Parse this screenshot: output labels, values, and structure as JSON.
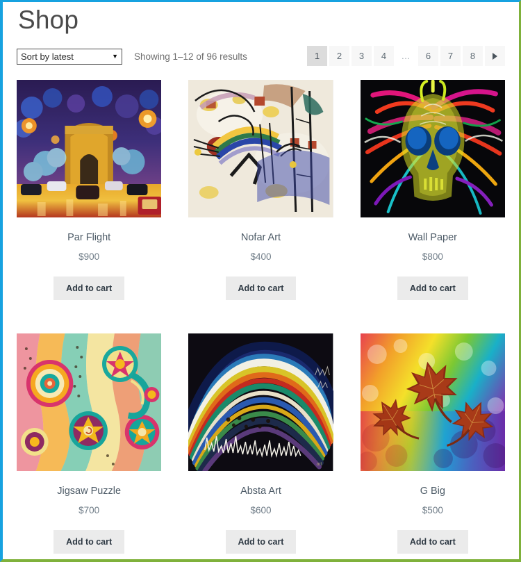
{
  "theme": {
    "border_top_left": "#17a2e0",
    "border_right_bottom": "#7fb13b",
    "button_bg": "#ebebeb",
    "pagination_active_bg": "#dcdcdc",
    "pagination_bg": "#f7f7f7"
  },
  "header": {
    "title": "Shop"
  },
  "toolbar": {
    "sort": {
      "selected": "Sort by latest",
      "options": [
        "Sort by latest"
      ],
      "caret": "▼"
    },
    "result_count": "Showing 1–12 of 96 results"
  },
  "pagination": {
    "items": [
      {
        "label": "1",
        "current": true
      },
      {
        "label": "2",
        "current": false
      },
      {
        "label": "3",
        "current": false
      },
      {
        "label": "4",
        "current": false
      },
      {
        "label": "…",
        "current": false,
        "dots": true
      },
      {
        "label": "6",
        "current": false
      },
      {
        "label": "7",
        "current": false
      },
      {
        "label": "8",
        "current": false
      }
    ],
    "next_label": "→",
    "next_icon": "arrow-right-icon"
  },
  "products": [
    {
      "title": "Par Flight",
      "price": "$900",
      "add_label": "Add to cart",
      "art": "arc-de-triomphe-night"
    },
    {
      "title": "Nofar Art",
      "price": "$400",
      "add_label": "Add to cart",
      "art": "kandinsky-abstract"
    },
    {
      "title": "Wall Paper",
      "price": "$800",
      "add_label": "Add to cart",
      "art": "neon-skull"
    },
    {
      "title": "Jigsaw Puzzle",
      "price": "$700",
      "add_label": "Add to cart",
      "art": "mandala-paisley"
    },
    {
      "title": "Absta Art",
      "price": "$600",
      "add_label": "Add to cart",
      "art": "rainbow-wave"
    },
    {
      "title": "G Big",
      "price": "$500",
      "add_label": "Add to cart",
      "art": "maple-leaves-rainbow"
    }
  ]
}
